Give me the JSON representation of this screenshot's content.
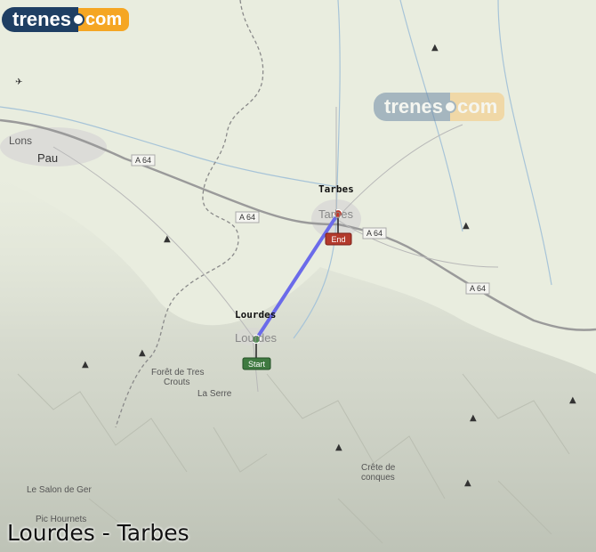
{
  "brand": {
    "part1": "trenes",
    "part2": "com"
  },
  "watermark": {
    "part1": "trenes",
    "part2": "com"
  },
  "title": "Lourdes - Tarbes",
  "stations": {
    "origin": "Lourdes",
    "destination": "Tarbes"
  },
  "markers": {
    "start": "Start",
    "end": "End"
  },
  "places": {
    "lons": "Lons",
    "pau": "Pau",
    "tarbes": "Tarbes",
    "lourdes": "Lourdes",
    "foret1": "Forêt de Tres",
    "foret2": "Crouts",
    "la_serre": "La Serre",
    "crete1": "Crête de",
    "crete2": "conques",
    "salon": "Le Salon de Ger",
    "pic": "Pic Hournets"
  },
  "roads": {
    "a64_1": "A 64",
    "a64_2": "A 64",
    "a64_3": "A 64",
    "a64_4": "A 64"
  },
  "colors": {
    "route": "#6b6bea",
    "start_marker": "#4f8a50",
    "end_marker": "#c0392b",
    "logo_dark": "#1f3f63",
    "logo_orange": "#f5a623"
  }
}
